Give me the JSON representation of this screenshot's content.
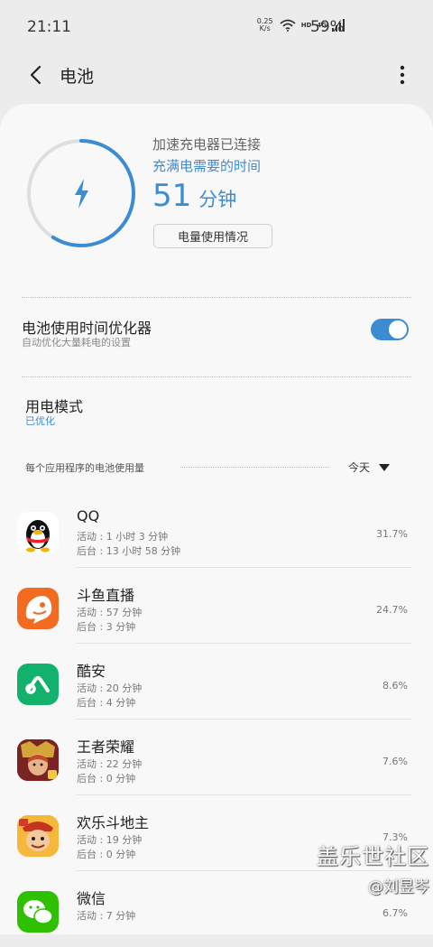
{
  "status_bar": {
    "time": "21:11",
    "net_speed_value": "0.25",
    "net_speed_unit": "K/s",
    "network_type": "HD",
    "signal_type": "4G",
    "battery": "59%"
  },
  "header": {
    "title": "电池"
  },
  "battery": {
    "charger_status": "加速充电器已连接",
    "time_label": "充满电需要的时间",
    "time_value": "51",
    "time_unit": "分钟",
    "usage_button": "电量使用情况",
    "charge_fraction": 0.59,
    "accent_color": "#3c8cd4"
  },
  "optimizer": {
    "title": "电池使用时间优化器",
    "subtitle": "自动优化大量耗电的设置",
    "enabled": true
  },
  "power_mode": {
    "title": "用电模式",
    "value": "已优化"
  },
  "usage_section": {
    "label": "每个应用程序的电池使用量",
    "filter": "今天"
  },
  "apps": [
    {
      "name": "QQ",
      "active": "活动 : 1 小时 3 分钟",
      "background": "后台 : 13 小时 58 分钟",
      "percent": "31.7%",
      "icon": "qq-penguin-icon"
    },
    {
      "name": "斗鱼直播",
      "active": "活动 : 57 分钟",
      "background": "后台 : 3 分钟",
      "percent": "24.7%",
      "icon": "douyu-fish-icon"
    },
    {
      "name": "酷安",
      "active": "活动 : 20 分钟",
      "background": "后台 : 4 分钟",
      "percent": "8.6%",
      "icon": "coolapk-icon"
    },
    {
      "name": "王者荣耀",
      "active": "活动 : 22 分钟",
      "background": "后台 : 0 分钟",
      "percent": "7.6%",
      "icon": "honor-of-kings-icon"
    },
    {
      "name": "欢乐斗地主",
      "active": "活动 : 19 分钟",
      "background": "后台 : 0 分钟",
      "percent": "7.3%",
      "icon": "doudizhu-icon"
    },
    {
      "name": "微信",
      "active": "活动 : 7 分钟",
      "background": "",
      "percent": "6.7%",
      "icon": "wechat-icon"
    }
  ],
  "watermark": {
    "main": "盖乐世社区",
    "sub": "@刘昱岑"
  }
}
